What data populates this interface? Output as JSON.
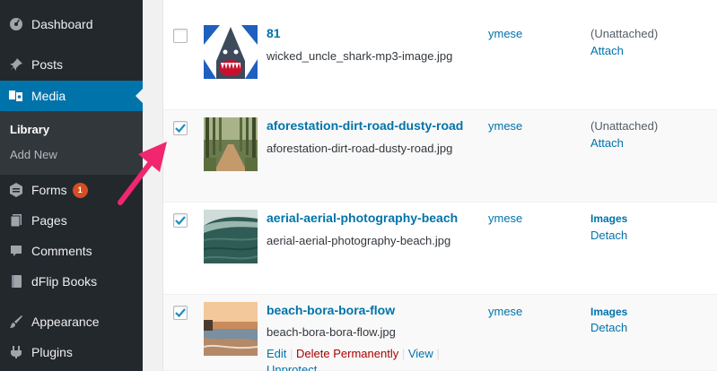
{
  "sidebar": {
    "items": [
      {
        "label": "Dashboard",
        "icon": "dashboard-icon"
      },
      {
        "label": "Posts",
        "icon": "pin-icon"
      },
      {
        "label": "Media",
        "icon": "media-icon"
      },
      {
        "label": "Forms",
        "icon": "forms-icon",
        "badge": "1"
      },
      {
        "label": "Pages",
        "icon": "pages-icon"
      },
      {
        "label": "Comments",
        "icon": "comment-icon"
      },
      {
        "label": "dFlip Books",
        "icon": "book-icon"
      },
      {
        "label": "Appearance",
        "icon": "brush-icon"
      },
      {
        "label": "Plugins",
        "icon": "plugin-icon"
      }
    ],
    "submenu": [
      {
        "label": "Library"
      },
      {
        "label": "Add New"
      }
    ]
  },
  "rows": [
    {
      "title": "81",
      "filename": "wicked_uncle_shark-mp3-image.jpg",
      "author": "ymese",
      "uploaded_to": "(Unattached)",
      "link": "Attach",
      "checked": false
    },
    {
      "title": "aforestation-dirt-road-dusty-road",
      "filename": "aforestation-dirt-road-dusty-road.jpg",
      "author": "ymese",
      "uploaded_to": "(Unattached)",
      "link": "Attach",
      "checked": true
    },
    {
      "title": "aerial-aerial-photography-beach",
      "filename": "aerial-aerial-photography-beach.jpg",
      "author": "ymese",
      "uploaded_to": "Images",
      "link": "Detach",
      "checked": true
    },
    {
      "title": "beach-bora-bora-flow",
      "filename": "beach-bora-bora-flow.jpg",
      "author": "ymese",
      "uploaded_to": "Images",
      "link": "Detach",
      "checked": true,
      "actions": {
        "edit": "Edit",
        "sep1": "|",
        "delete": "Delete Permanently",
        "sep2": "|",
        "view": "View",
        "sep3": "|",
        "unprotect": "Unprotect"
      }
    }
  ],
  "colors": {
    "accent": "#0073aa",
    "sidebar": "#23282d",
    "arrow": "#f0266f"
  }
}
